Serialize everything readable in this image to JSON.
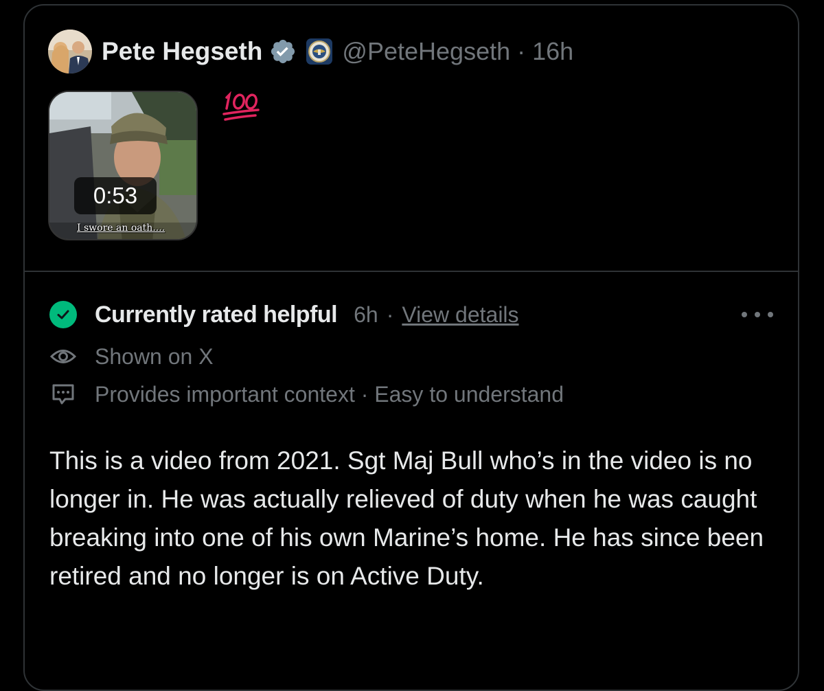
{
  "tweet": {
    "author_name": "Pete Hegseth",
    "handle": "@PeteHegseth",
    "separator": "·",
    "time": "16h",
    "text": "💯",
    "video": {
      "duration": "0:53",
      "caption": "I swore an oath...."
    }
  },
  "community_note": {
    "status": "Currently rated helpful",
    "time": "6h",
    "separator": "·",
    "view_details": "View details",
    "shown_on": "Shown on X",
    "reasons": "Provides important context · Easy to understand",
    "body": "This is a video from 2021. Sgt Maj Bull who’s in the video is no longer in. He was actually relieved of duty when he was caught breaking into one of his own Marine’s home. He has since been retired and no longer is on Active Duty."
  },
  "colors": {
    "background": "#000000",
    "border": "#2f3336",
    "primary_text": "#e7e9ea",
    "secondary_text": "#71767b",
    "helpful_green": "#00ba7c",
    "verified_gray": "#829aab",
    "emoji_red": "#e0245e"
  },
  "icons": [
    "verified-badge-icon",
    "affiliate-badge-icon",
    "check-icon",
    "eye-icon",
    "comment-dots-icon",
    "more-dots-icon"
  ]
}
